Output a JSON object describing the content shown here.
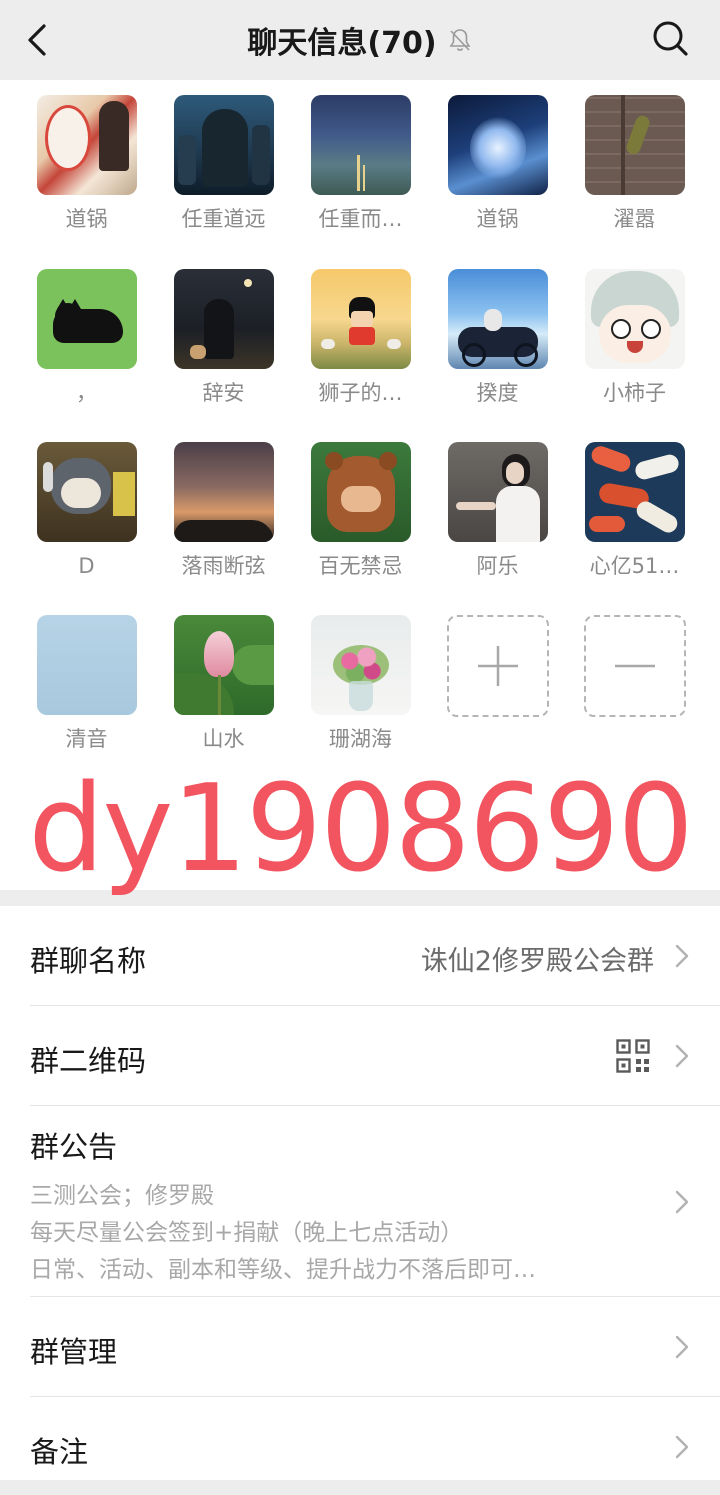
{
  "header": {
    "title": "聊天信息(70)"
  },
  "members": [
    {
      "name": "道锅"
    },
    {
      "name": "任重道远"
    },
    {
      "name": "任重而…"
    },
    {
      "name": "道锅"
    },
    {
      "name": "濯嚣"
    },
    {
      "name": "，"
    },
    {
      "name": "辞安"
    },
    {
      "name": "狮子的…"
    },
    {
      "name": "揆度"
    },
    {
      "name": "小柿子"
    },
    {
      "name": "D"
    },
    {
      "name": "落雨断弦"
    },
    {
      "name": "百无禁忌"
    },
    {
      "name": "阿乐"
    },
    {
      "name": "心亿51…"
    },
    {
      "name": "清音"
    },
    {
      "name": "山水"
    },
    {
      "name": "珊湖海"
    }
  ],
  "watermark": "dy1908690",
  "settings": {
    "group_name_label": "群聊名称",
    "group_name_value": "诛仙2修罗殿公会群",
    "qr_label": "群二维码",
    "notice_label": "群公告",
    "notice_lines": [
      "三测公会；修罗殿",
      "每天尽量公会签到+捐献（晚上七点活动）",
      "日常、活动、副本和等级、提升战力不落后即可…"
    ],
    "manage_label": "群管理",
    "remark_label": "备注"
  },
  "colors": {
    "background": "#ededed",
    "panel": "#ffffff",
    "watermark": "#f2555f",
    "secondary_text": "#8a8a8a"
  }
}
